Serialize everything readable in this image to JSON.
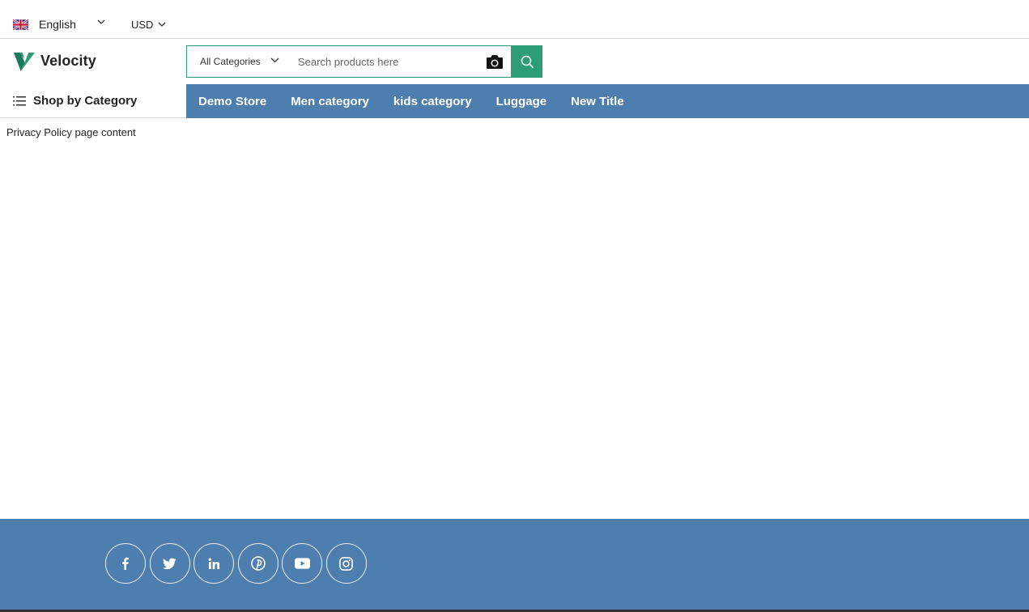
{
  "topbar": {
    "language": {
      "label": "English",
      "flag": "uk-flag-icon"
    },
    "currency": {
      "label": "USD"
    }
  },
  "header": {
    "logo_text": "Velocity",
    "search": {
      "category_label": "All Categories",
      "placeholder": "Search products here",
      "value": ""
    }
  },
  "nav": {
    "shop_by_category": "Shop by Category",
    "links": [
      "Demo Store",
      "Men category",
      "kids category",
      "Luggage",
      "New Title"
    ]
  },
  "content": {
    "text": "Privacy Policy page content"
  },
  "footer": {
    "socials": [
      "facebook-icon",
      "twitter-icon",
      "linkedin-icon",
      "pinterest-icon",
      "youtube-icon",
      "instagram-icon"
    ]
  },
  "colors": {
    "accent_green": "#2d9d78",
    "nav_blue": "#4d7ead",
    "text": "#242424"
  }
}
